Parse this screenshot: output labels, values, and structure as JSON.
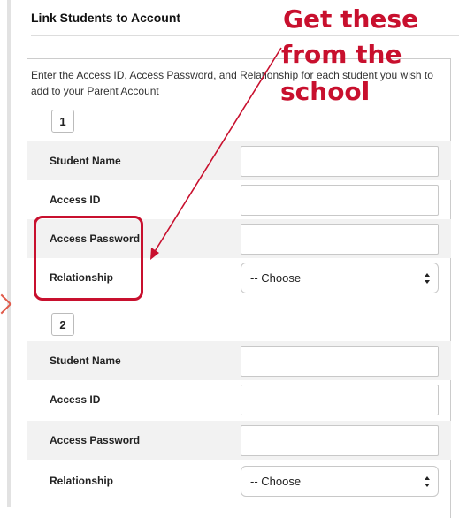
{
  "section": {
    "title": "Link Students to Account",
    "instructions": "Enter the Access ID, Access Password, and Relationship for each student you wish to add to your Parent Account"
  },
  "students": [
    {
      "number": "1",
      "fields": {
        "student_name_label": "Student Name",
        "student_name_value": "",
        "access_id_label": "Access ID",
        "access_id_value": "",
        "access_password_label": "Access Password",
        "access_password_value": "",
        "relationship_label": "Relationship",
        "relationship_value": "-- Choose"
      }
    },
    {
      "number": "2",
      "fields": {
        "student_name_label": "Student Name",
        "student_name_value": "",
        "access_id_label": "Access ID",
        "access_id_value": "",
        "access_password_label": "Access Password",
        "access_password_value": "",
        "relationship_label": "Relationship",
        "relationship_value": "-- Choose"
      }
    }
  ],
  "annotation": {
    "line1": "Get these",
    "line2": "from the",
    "line3": "school",
    "color": "#c8102e"
  },
  "icons": {
    "select_arrows": "updown-chevron-icon",
    "side_arrow": "chevron-right-icon"
  }
}
